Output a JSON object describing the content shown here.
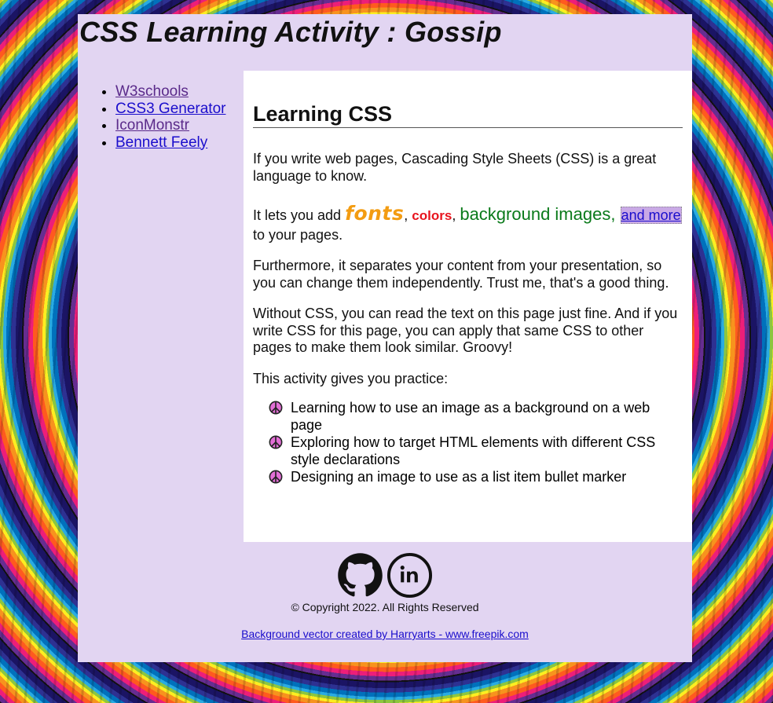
{
  "header": {
    "title": "CSS Learning Activity : Gossip"
  },
  "sidebar": {
    "links": [
      {
        "label": "W3schools",
        "visited": true
      },
      {
        "label": "CSS3 Generator",
        "visited": false
      },
      {
        "label": "IconMonstr",
        "visited": true
      },
      {
        "label": "Bennett Feely",
        "visited": false
      }
    ]
  },
  "main": {
    "heading": "Learning CSS",
    "p1": "If you write web pages, Cascading Style Sheets (CSS) is a great language to know.",
    "p2": {
      "prefix": "It lets you add ",
      "fonts": "fonts",
      "sep1": ", ",
      "colors": "colors",
      "sep2": ", ",
      "background_images": "background images",
      "sep3": ", ",
      "and_more": "and more",
      "suffix": " to your pages."
    },
    "p3": "Furthermore, it separates your content from your presentation, so you can change them independently. Trust me, that's a good thing.",
    "p4": "Without CSS, you can read the text on this page just fine. And if you write CSS for this page, you can apply that same CSS to other pages to make them look similar. Groovy!",
    "p5": "This activity gives you practice:",
    "practice_items": [
      "Learning how to use an image as a background on a web page",
      "Exploring how to target HTML elements with different CSS style declarations",
      "Designing an image to use as a list item bullet marker"
    ],
    "bullet_icon": "peace-sign-icon"
  },
  "footer": {
    "social_icons": [
      "github-icon",
      "linkedin-icon"
    ],
    "copyright": "© Copyright 2022. All Rights Reserved",
    "credit_link": "Background vector created by Harryarts - www.freepik.com"
  },
  "colors": {
    "panel_lavender": "#e2d5f2",
    "link_blue": "#1a0dcc",
    "link_visited": "#5a2a8a",
    "fonts_orange": "#f39c12",
    "colors_red": "#e8141e",
    "bg_green": "#0a7a1a",
    "highlight_purple": "#c9a9e6",
    "peace_pink": "#e36fd6"
  }
}
